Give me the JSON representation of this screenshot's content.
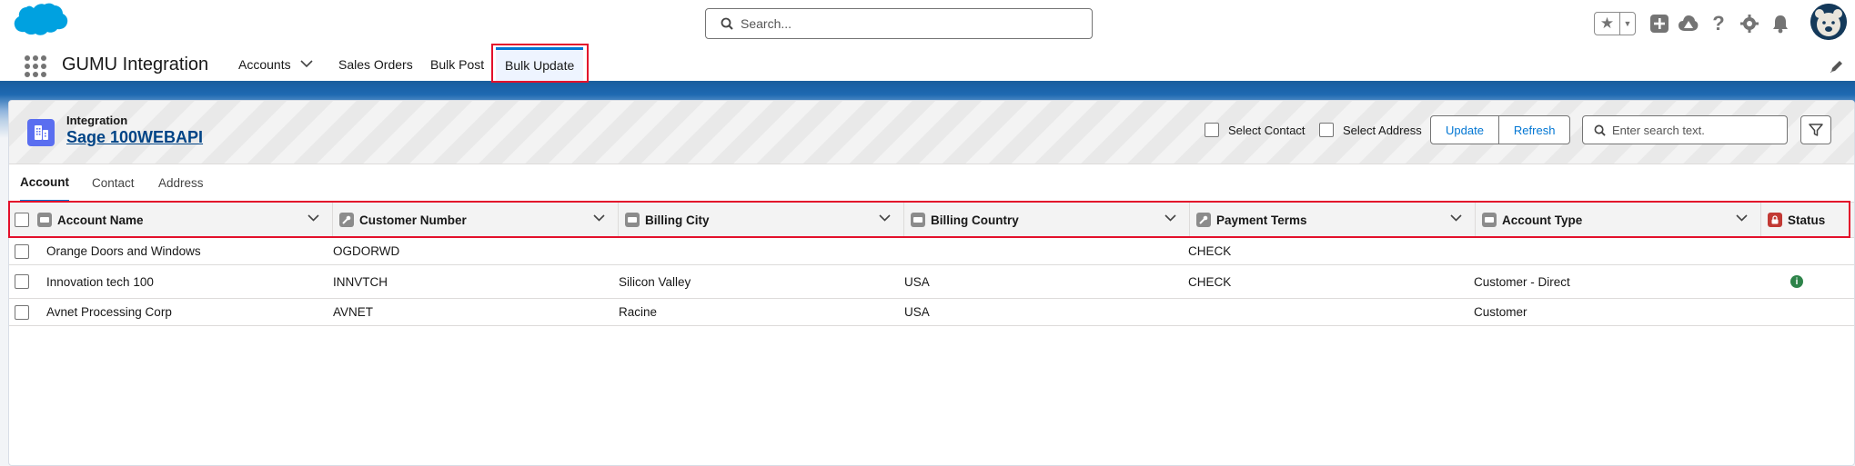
{
  "header": {
    "search_placeholder": "Search...",
    "icons": [
      "favorites-star-icon",
      "favorites-dropdown-icon",
      "global-add-icon",
      "trailhead-icon",
      "help-icon",
      "setup-gear-icon",
      "notifications-bell-icon",
      "user-avatar"
    ]
  },
  "nav": {
    "app_name": "GUMU Integration",
    "items": [
      {
        "label": "Accounts",
        "has_menu": true
      },
      {
        "label": "Sales Orders"
      },
      {
        "label": "Bulk Post"
      },
      {
        "label": "Bulk Update",
        "active": true
      }
    ]
  },
  "card": {
    "object_label": "Integration",
    "record_title": "Sage 100WEBAPI",
    "select_contact_label": "Select Contact",
    "select_address_label": "Select Address",
    "update_label": "Update",
    "refresh_label": "Refresh",
    "search_placeholder": "Enter search text."
  },
  "tabs": [
    {
      "label": "Account",
      "active": true
    },
    {
      "label": "Contact"
    },
    {
      "label": "Address"
    }
  ],
  "table": {
    "columns": [
      {
        "label": "Account Name"
      },
      {
        "label": "Customer Number"
      },
      {
        "label": "Billing City"
      },
      {
        "label": "Billing Country"
      },
      {
        "label": "Payment Terms"
      },
      {
        "label": "Account Type"
      },
      {
        "label": "Status"
      }
    ],
    "rows": [
      {
        "account_name": "Orange Doors and Windows",
        "customer_number": "OGDORWD",
        "billing_city": "",
        "billing_country": "",
        "payment_terms": "CHECK",
        "account_type": "",
        "status": ""
      },
      {
        "account_name": "Innovation tech 100",
        "customer_number": "INNVTCH",
        "billing_city": "Silicon Valley",
        "billing_country": "USA",
        "payment_terms": "CHECK",
        "account_type": "Customer - Direct",
        "status": "info"
      },
      {
        "account_name": "Avnet Processing Corp",
        "customer_number": "AVNET",
        "billing_city": "Racine",
        "billing_country": "USA",
        "payment_terms": "",
        "account_type": "Customer",
        "status": ""
      }
    ]
  },
  "colors": {
    "brand_blue": "#0176d3",
    "band_blue": "#1b5f9e",
    "highlight_red": "#e3102b",
    "status_green": "#2e844a"
  }
}
